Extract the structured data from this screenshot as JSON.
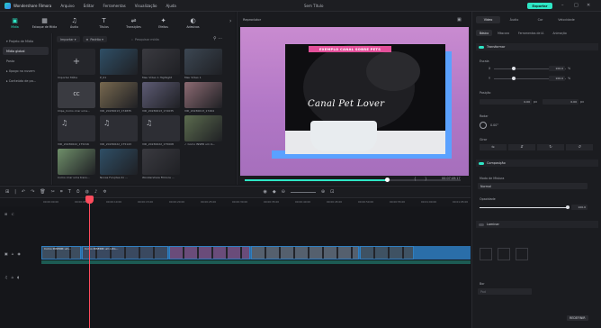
{
  "app": {
    "name": "Wondershare Filmora",
    "project": "Sem Título",
    "export_label": "Exportar"
  },
  "menu": [
    "Arquivo",
    "Editar",
    "Ferramentas",
    "Visualização",
    "Ajuda"
  ],
  "toolbar": [
    {
      "label": "Mídia",
      "icon": "media-icon",
      "glyph": "▣",
      "active": true
    },
    {
      "label": "Estoque de Mídia",
      "icon": "stock-media-icon",
      "glyph": "▦",
      "active": false
    },
    {
      "label": "Áudio",
      "icon": "music-note-icon",
      "glyph": "♫",
      "active": false
    },
    {
      "label": "Títulos",
      "icon": "text-icon",
      "glyph": "T",
      "active": false
    },
    {
      "label": "Transições",
      "icon": "transition-icon",
      "glyph": "⇌",
      "active": false
    },
    {
      "label": "Efeitos",
      "icon": "effects-icon",
      "glyph": "✦",
      "active": false
    },
    {
      "label": "Adesivos",
      "icon": "sticker-icon",
      "glyph": "◐",
      "active": false
    }
  ],
  "sidebar": {
    "items": [
      {
        "label": "▾ Projeto de Mídia",
        "active": false
      },
      {
        "label": "Mídia global",
        "active": true
      },
      {
        "label": "Pasta",
        "active": false
      },
      {
        "label": "▸ Xpogo na nuvem",
        "active": false
      },
      {
        "label": "▸ Conteúdo de pa...",
        "active": false
      }
    ]
  },
  "library": {
    "filter1": "Importar ▾",
    "filter2": "Padrão ▾",
    "search_placeholder": "Pesquisar mídia",
    "tiles": [
      {
        "label": "Importar Mídia",
        "kind": "import"
      },
      {
        "label": "P_01",
        "kind": "photo"
      },
      {
        "label": "Meu Vídeo 1 Highlight",
        "kind": "photo"
      },
      {
        "label": "Meu Vídeo 1",
        "kind": "photo"
      },
      {
        "label": "Clipe_Como criar uma...",
        "kind": "cc"
      },
      {
        "label": "VID_20230613_174835",
        "kind": "photo"
      },
      {
        "label": "VID_20230613_172035",
        "kind": "photo"
      },
      {
        "label": "VID_20230613_17264",
        "kind": "photo"
      },
      {
        "label": "VID_20230622_175216",
        "kind": "audio"
      },
      {
        "label": "VID_20230622_175143",
        "kind": "audio"
      },
      {
        "label": "VID_20230622_175008",
        "kind": "audio"
      },
      {
        "label": "✓ Como INSER um lo...",
        "kind": "photo"
      },
      {
        "label": "Como criar uma trans...",
        "kind": "photo"
      },
      {
        "label": "Novas Funções do ...",
        "kind": "photo"
      },
      {
        "label": "Wondershare Filmora ...",
        "kind": "photo"
      }
    ]
  },
  "preview": {
    "label": "Reprodutor",
    "banner": "EXEMPLO CANAL SOBRE PETS",
    "overlay_text": "Canal Pet Lover",
    "timecode": "00:07:49:17",
    "quality": "Qualidade total",
    "progress": 0.66
  },
  "properties": {
    "tabs": [
      {
        "label": "Vídeo",
        "active": true
      },
      {
        "label": "Áudio",
        "active": false
      },
      {
        "label": "Cor",
        "active": false
      },
      {
        "label": "Velocidade",
        "active": false
      }
    ],
    "subtabs": [
      {
        "label": "Básico",
        "active": true
      },
      {
        "label": "Máscara",
        "active": false
      },
      {
        "label": "Ferramentas de IA",
        "active": false
      },
      {
        "label": "Animação",
        "active": false
      }
    ],
    "transform": {
      "title": "Transformar",
      "scale_label": "Escala",
      "x_label": "X",
      "x_value": "100.0",
      "y_label": "Y",
      "y_value": "100.0",
      "pct": "%",
      "position_label": "Posição",
      "pos_x": "0.00",
      "pos_y": "0.00",
      "px": "px",
      "rotate_label": "Rodar",
      "rotate_value": "0.00°",
      "flip_label": "Girar"
    },
    "compose": {
      "title": "Composição",
      "blend_label": "Modo de Mistura",
      "blend_value": "Normal",
      "opacity_label": "Opacidade",
      "opacity_value": "100.0"
    },
    "fill": {
      "title": "Laminar",
      "value_label": "Bor",
      "hint": "Pad"
    },
    "reset_label": "REDEFINIR"
  },
  "timeline": {
    "ticks": [
      "00:00:00:00",
      "00:00:05:00",
      "00:00:10:00",
      "00:00:15:00",
      "00:00:20:00",
      "00:00:25:00",
      "00:00:30:00",
      "00:00:35:00",
      "00:00:40:00",
      "00:00:45:00",
      "00:00:50:00",
      "00:00:55:00",
      "00:01:00:00",
      "00:01:05:00"
    ],
    "clips": [
      {
        "label": "Como INSERIR um...",
        "width": 44
      },
      {
        "label": "Como INSERIR um LOG...",
        "width": 96
      },
      {
        "label": "",
        "width": 90
      },
      {
        "label": "",
        "width": 120
      },
      {
        "label": "",
        "width": 60
      }
    ]
  }
}
